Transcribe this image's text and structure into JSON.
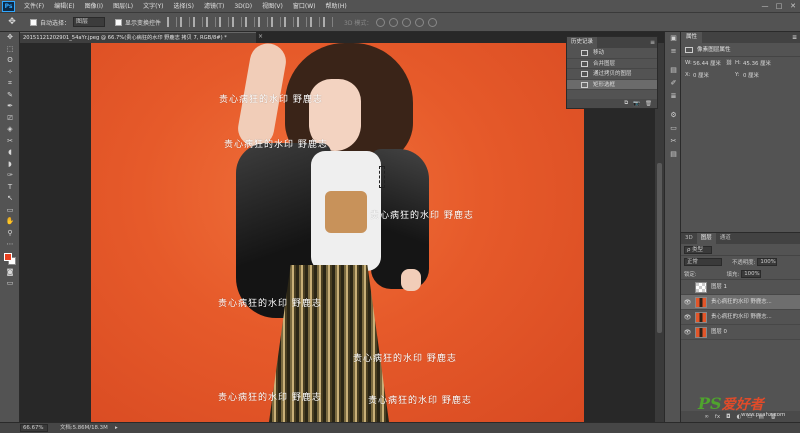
{
  "app": {
    "logo": "Ps"
  },
  "menu": [
    "文件(F)",
    "编辑(E)",
    "图像(I)",
    "图层(L)",
    "文字(Y)",
    "选择(S)",
    "滤镜(T)",
    "3D(D)",
    "视图(V)",
    "窗口(W)",
    "帮助(H)"
  ],
  "window_controls": [
    "—",
    "□",
    "✕"
  ],
  "options": {
    "auto_select_label": "自动选择：",
    "auto_select_value": "图层",
    "show_transform_label": "显示变换控件",
    "mode_3d_label": "3D 模式："
  },
  "tools": [
    "✥",
    "⬚",
    "ʘ",
    "✧",
    "⌗",
    "✎",
    "✒",
    "⎚",
    "◈",
    "✂",
    "◖",
    "◗",
    "✑",
    "T",
    "↖",
    "▭",
    "✋",
    "⚲",
    "⋯"
  ],
  "document": {
    "tab_title": "20151121202901_54aYr.jpeg @ 66.7%(贵心病狂的水印 野鹿志 拷贝 7, RGB/8#) *",
    "tab_close": "×"
  },
  "watermarks": [
    "贵心病狂的水印  野鹿志",
    "贵心病狂的水印  野鹿志",
    "贵心病狂的水印  野鹿志",
    "贵心病狂的水印  野鹿志",
    "贵心病狂的水印  野鹿志",
    "贵心病狂的水印  野鹿志",
    "贵心病狂的水印  野鹿志"
  ],
  "status": {
    "zoom": "66.67%",
    "doc_info": "文档:5.86M/18.3M",
    "arrow": "▸"
  },
  "history": {
    "tab": "历史记录",
    "menu_icon": "≡",
    "items": [
      "移动",
      "合并图层",
      "通过拷贝的图层",
      "矩形选框"
    ],
    "active_index": 3,
    "footer_icons": [
      "⧉",
      "📷",
      "🗑"
    ]
  },
  "dock_icons": [
    "▣",
    "≡",
    "▤",
    "✐",
    "≣",
    "⚙",
    "▭",
    "✂",
    "▤"
  ],
  "properties": {
    "tab": "属性",
    "menu_icon": "≡",
    "header": "像素图层属性",
    "w_label": "W:",
    "w_value": "56.44 厘米",
    "h_label": "H:",
    "h_value": "45.36 厘米",
    "x_label": "X:",
    "x_value": "0 厘米",
    "y_label": "Y:",
    "y_value": "0 厘米",
    "link_icon": "⛓"
  },
  "layers": {
    "tabs": [
      "3D",
      "图层",
      "通道"
    ],
    "active_tab": "图层",
    "filter_label": "ρ 类型",
    "blend_mode": "正常",
    "opacity_label": "不透明度:",
    "opacity_value": "100%",
    "lock_label": "锁定:",
    "fill_label": "填充:",
    "fill_value": "100%",
    "items": [
      {
        "name": "图层 1",
        "visible": false,
        "thumb": "blank"
      },
      {
        "name": "贵心病狂的水印 野鹿志...",
        "visible": true,
        "thumb": "photo"
      },
      {
        "name": "贵心病狂的水印 野鹿志...",
        "visible": true,
        "thumb": "photo"
      },
      {
        "name": "图层 0",
        "visible": true,
        "thumb": "photo"
      }
    ],
    "selected_index": 1,
    "eye_icon": "👁",
    "footer_icons": [
      "∞",
      "fx",
      "◘",
      "◐",
      "▭",
      "▤",
      "🗑"
    ]
  },
  "site": {
    "logo_text": "PS",
    "logo_cn": "爱好者",
    "url": "www.psahz.com"
  },
  "colors": {
    "accent_ps": "#31a8ff",
    "canvas_bg": "#e65a2a",
    "foreground": "#e8401f",
    "background": "#ffffff"
  }
}
